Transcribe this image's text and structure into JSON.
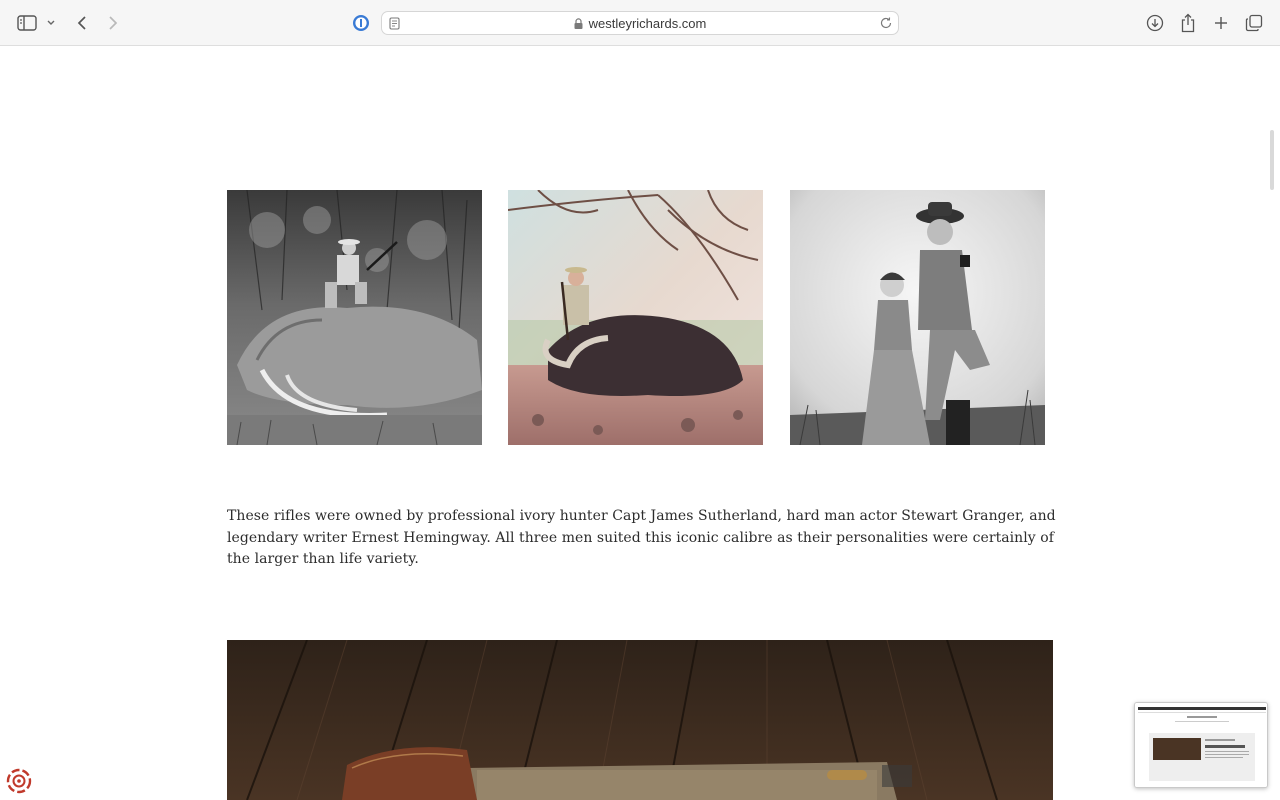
{
  "browser": {
    "url": "westleyrichards.com",
    "icons": [
      "sidebar-icon",
      "chevron-down-icon",
      "back-icon",
      "forward-icon",
      "password-manager-icon",
      "reader-icon",
      "lock-icon",
      "reload-icon",
      "downloads-icon",
      "share-icon",
      "new-tab-icon",
      "tab-overview-icon"
    ]
  },
  "page": {
    "photos": [
      {
        "name": "hunter-on-elephant-photo"
      },
      {
        "name": "hunter-with-buffalo-photo"
      },
      {
        "name": "actor-couple-photo"
      }
    ],
    "caption": "These rifles were owned by professional ivory hunter Capt James Sutherland, hard man actor Stewart Granger, and legendary writer Ernest Hemingway.  All three men suited this iconic calibre as their personalities were certainly of the larger than life variety."
  },
  "colors": {
    "toolbar_bg": "#f6f6f6",
    "text": "#2c2c2c",
    "accent_badge": "#c0392b"
  }
}
